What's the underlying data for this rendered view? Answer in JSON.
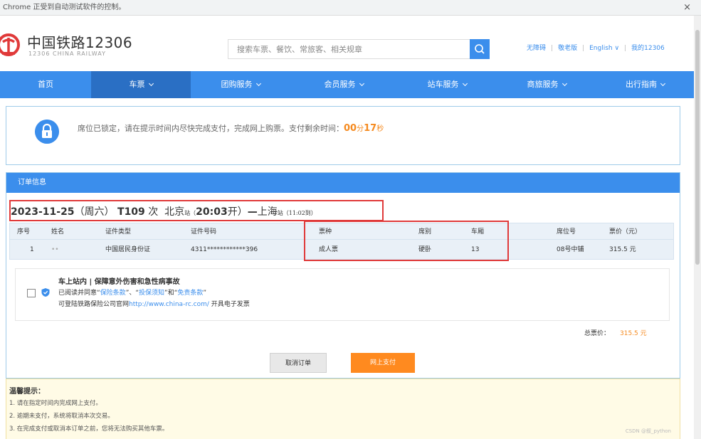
{
  "infobar": {
    "text": "Chrome 正受到自动测试软件的控制。",
    "close": "×"
  },
  "header": {
    "logo_cn": "中国铁路12306",
    "logo_en": "12306 CHINA RAILWAY",
    "search_placeholder": "搜索车票、餐饮、常旅客、相关规章",
    "links": [
      "无障碍",
      "敬老版",
      "English ∨",
      "我的12306"
    ]
  },
  "nav": [
    "首页",
    "车票",
    "团购服务",
    "会员服务",
    "站车服务",
    "商旅服务",
    "出行指南"
  ],
  "notice": {
    "text": "席位已锁定，请在提示时间内尽快完成支付，完成网上购票。支付剩余时间：",
    "minutes": "00",
    "min_unit": "分",
    "seconds": "17",
    "sec_unit": "秒"
  },
  "order": {
    "header": "订单信息",
    "date": "2023-11-25",
    "weekday": "（周六）",
    "train": "T109",
    "train_suffix": " 次",
    "from": "北京",
    "from_suffix": "站（",
    "depart_time": "20:03",
    "depart_suffix": "开）",
    "dash": "—",
    "to": "上海",
    "arrive": "站（11:02到）",
    "columns": [
      "序号",
      "姓名",
      "证件类型",
      "证件号码",
      "票种",
      "席别",
      "车厢",
      "席位号",
      "票价（元）"
    ],
    "row": {
      "index": "1",
      "name": "••",
      "id_type": "中国居民身份证",
      "id_number": "4311************396",
      "ticket_type": "成人票",
      "seat_class": "硬卧",
      "coach": "13",
      "seat_no": "08号中铺",
      "price": "315.5 元"
    },
    "insurance": {
      "title": "车上站内 | 保障意外伤害和急性病事故",
      "line1_a": "已阅读并同意“",
      "line1_b": "保险条款",
      "line1_c": "”、“",
      "line1_d": "投保须知",
      "line1_e": "”和“",
      "line1_f": "免责条款",
      "line1_g": "”",
      "line2_a": "可登陆铁路保险公司官网",
      "line2_b": "http://www.china-rc.com/",
      "line2_c": " 开具电子发票"
    },
    "total_label": "总票价：",
    "total_value": "315.5 元",
    "cancel_label": "取消订单",
    "pay_label": "网上支付"
  },
  "tips": {
    "title": "温馨提示：",
    "items": [
      "1. 请在指定时间内完成网上支付。",
      "2. 逾期未支付，系统将取消本次交易。",
      "3. 在完成支付或取消本订单之前，您将无法购买其他车票。"
    ],
    "watermark": "CSDN @叙_python"
  },
  "colors": {
    "primary": "#3b8eec",
    "accent": "#ff8a1f",
    "highlight": "#e03a3a"
  }
}
